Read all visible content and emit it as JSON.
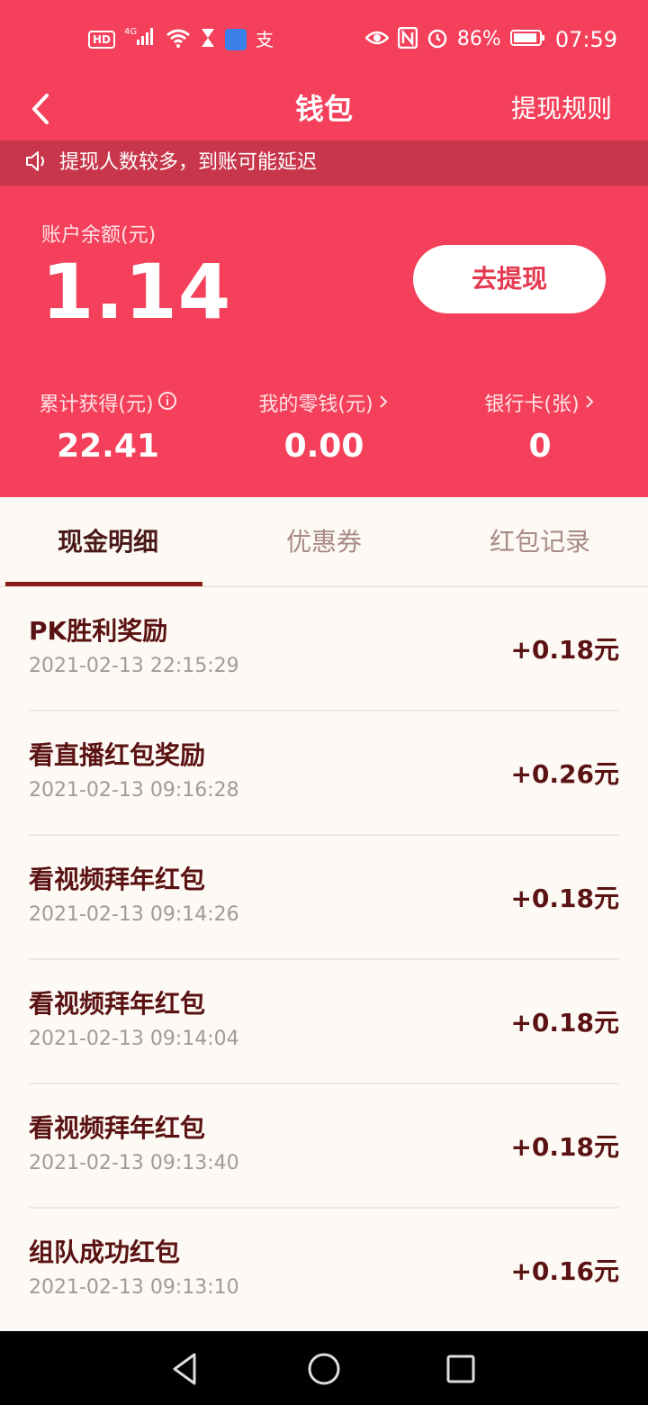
{
  "status_bar": {
    "hd": "HD",
    "network": "4G",
    "alipay": "支",
    "battery": "86%",
    "time": "07:59"
  },
  "nav": {
    "title": "钱包",
    "rules": "提现规则"
  },
  "notice": {
    "text": "提现人数较多，到账可能延迟"
  },
  "balance": {
    "label": "账户余额(元)",
    "value": "1.14",
    "withdraw": "去提现"
  },
  "stats": [
    {
      "label": "累计获得(元)",
      "value": "22.41"
    },
    {
      "label": "我的零钱(元)",
      "value": "0.00"
    },
    {
      "label": "银行卡(张)",
      "value": "0"
    }
  ],
  "tabs": [
    {
      "label": "现金明细",
      "active": true
    },
    {
      "label": "优惠券",
      "active": false
    },
    {
      "label": "红包记录",
      "active": false
    }
  ],
  "records": [
    {
      "title": "PK胜利奖励",
      "time": "2021-02-13 22:15:29",
      "amount": "+0.18元"
    },
    {
      "title": "看直播红包奖励",
      "time": "2021-02-13 09:16:28",
      "amount": "+0.26元"
    },
    {
      "title": "看视频拜年红包",
      "time": "2021-02-13 09:14:26",
      "amount": "+0.18元"
    },
    {
      "title": "看视频拜年红包",
      "time": "2021-02-13 09:14:04",
      "amount": "+0.18元"
    },
    {
      "title": "看视频拜年红包",
      "time": "2021-02-13 09:13:40",
      "amount": "+0.18元"
    },
    {
      "title": "组队成功红包",
      "time": "2021-02-13 09:13:10",
      "amount": "+0.16元"
    }
  ],
  "colors": {
    "header_red": "#f4405a",
    "notice_red": "#c8364c",
    "text_dark": "#5a1212",
    "tab_underline": "#8a1c1c"
  }
}
